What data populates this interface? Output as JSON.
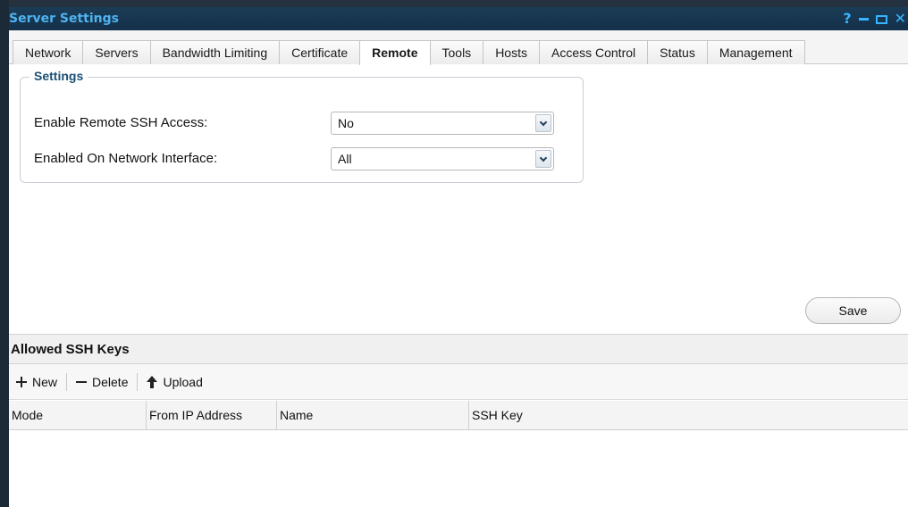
{
  "window": {
    "title": "Server Settings",
    "help_label": "?"
  },
  "tabs": [
    {
      "label": "Network",
      "active": false
    },
    {
      "label": "Servers",
      "active": false
    },
    {
      "label": "Bandwidth Limiting",
      "active": false
    },
    {
      "label": "Certificate",
      "active": false
    },
    {
      "label": "Remote",
      "active": true
    },
    {
      "label": "Tools",
      "active": false
    },
    {
      "label": "Hosts",
      "active": false
    },
    {
      "label": "Access Control",
      "active": false
    },
    {
      "label": "Status",
      "active": false
    },
    {
      "label": "Management",
      "active": false
    }
  ],
  "settings": {
    "legend": "Settings",
    "ssh_access": {
      "label": "Enable Remote SSH Access:",
      "value": "No"
    },
    "network_interface": {
      "label": "Enabled On Network Interface:",
      "value": "All"
    }
  },
  "save_label": "Save",
  "ssh_keys": {
    "title": "Allowed SSH Keys",
    "toolbar": {
      "new_label": "New",
      "delete_label": "Delete",
      "upload_label": "Upload"
    },
    "columns": [
      "Mode",
      "From IP Address",
      "Name",
      "SSH Key"
    ],
    "rows": []
  },
  "colors": {
    "title_bar": "#1b3c56",
    "title_text": "#4fb3f0",
    "window_controls": "#36b4ff",
    "legend_text": "#1b4f74"
  },
  "icons": {
    "new": "plus-icon",
    "delete": "minus-icon",
    "upload": "upload-arrow-icon",
    "dropdown": "chevron-down-icon"
  }
}
